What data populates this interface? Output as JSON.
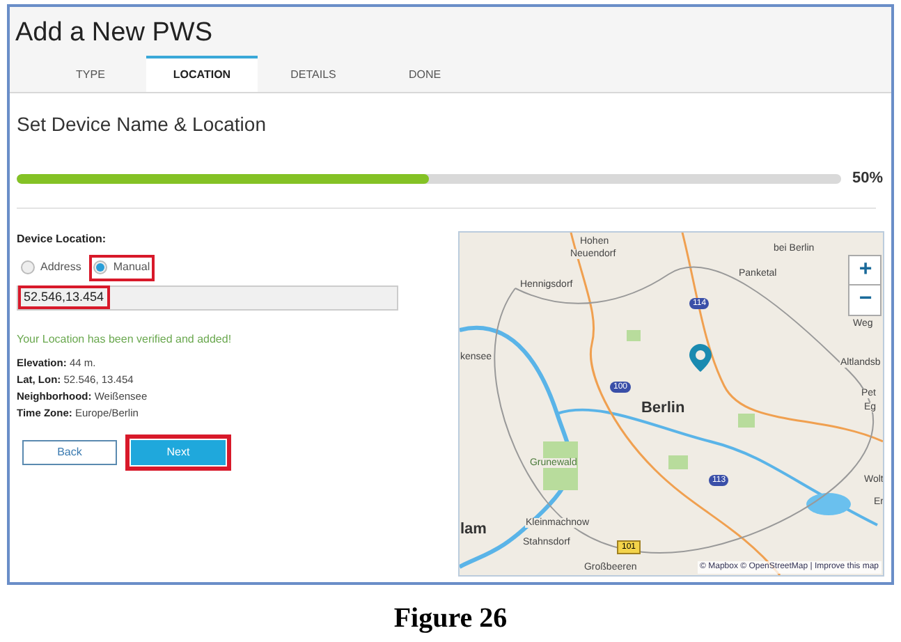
{
  "window": {
    "title": "Add a New PWS"
  },
  "tabs": [
    {
      "label": "TYPE",
      "selected": false
    },
    {
      "label": "LOCATION",
      "selected": true
    },
    {
      "label": "DETAILS",
      "selected": false
    },
    {
      "label": "DONE",
      "selected": false
    }
  ],
  "section_title": "Set Device Name & Location",
  "progress": {
    "level": 0.5,
    "reading": "50%"
  },
  "location": {
    "label": "Device Location:",
    "options": [
      {
        "label": "Address",
        "selected": false,
        "highlighted": false
      },
      {
        "label": "Manual",
        "selected": true,
        "highlighted": true
      }
    ],
    "input": {
      "value": "52.546,13.454",
      "highlighted": true
    },
    "message": "Your Location has been verified and added!",
    "details": [
      {
        "label": "Elevation:",
        "value": "44 m."
      },
      {
        "label": "Lat, Lon:",
        "value": "52.546, 13.454"
      },
      {
        "label": "Neighborhood:",
        "value": "Weißensee"
      },
      {
        "label": "Time Zone:",
        "value": "Europe/Berlin"
      }
    ]
  },
  "buttons": [
    {
      "label": "Back",
      "kind": "secondary",
      "highlighted": false
    },
    {
      "label": "Next",
      "kind": "primary",
      "highlighted": true
    }
  ],
  "map": {
    "labels": [
      {
        "text": "Hohen",
        "kind": "place"
      },
      {
        "text": "Neuendorf",
        "kind": "place"
      },
      {
        "text": "bei Berlin",
        "kind": "place"
      },
      {
        "text": "Panketal",
        "kind": "place"
      },
      {
        "text": "Hennigsdorf",
        "kind": "place"
      },
      {
        "text": "kensee",
        "kind": "place"
      },
      {
        "text": "Weg",
        "kind": "place"
      },
      {
        "text": "Altlandsb",
        "kind": "place"
      },
      {
        "text": "Pet",
        "kind": "place"
      },
      {
        "text": "Eg",
        "kind": "place"
      },
      {
        "text": "Berlin",
        "kind": "city"
      },
      {
        "text": "Grunewald",
        "kind": "park"
      },
      {
        "text": "Wolt",
        "kind": "place"
      },
      {
        "text": "Er",
        "kind": "place"
      },
      {
        "text": "lam",
        "kind": "city"
      },
      {
        "text": "Kleinmachnow",
        "kind": "place"
      },
      {
        "text": "Stahnsdorf",
        "kind": "place"
      },
      {
        "text": "Großbeeren",
        "kind": "place"
      },
      {
        "text": "114",
        "kind": "motorway"
      },
      {
        "text": "100",
        "kind": "motorway"
      },
      {
        "text": "113",
        "kind": "motorway"
      },
      {
        "text": "101",
        "kind": "road"
      }
    ],
    "zoom_in": "+",
    "zoom_out": "−",
    "attribution": "© Mapbox © OpenStreetMap | Improve this map"
  },
  "caption": "Figure 26"
}
